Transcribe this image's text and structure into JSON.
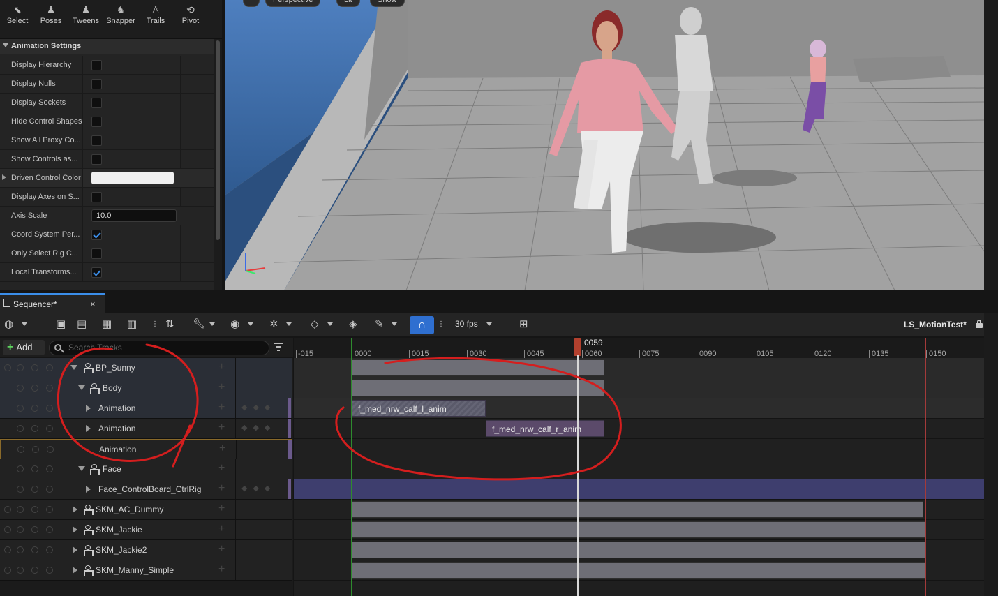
{
  "toolbar": {
    "tools": [
      {
        "label": "Select",
        "icon": "select-cursor-icon"
      },
      {
        "label": "Poses",
        "icon": "poses-icon"
      },
      {
        "label": "Tweens",
        "icon": "tweens-icon"
      },
      {
        "label": "Snapper",
        "icon": "snapper-icon"
      },
      {
        "label": "Trails",
        "icon": "trails-icon"
      },
      {
        "label": "Pivot",
        "icon": "pivot-icon"
      }
    ]
  },
  "animation_settings": {
    "header": "Animation Settings",
    "rows": [
      {
        "label": "Display Hierarchy",
        "type": "checkbox",
        "checked": false
      },
      {
        "label": "Display Nulls",
        "type": "checkbox",
        "checked": false
      },
      {
        "label": "Display Sockets",
        "type": "checkbox",
        "checked": false
      },
      {
        "label": "Hide Control Shapes",
        "type": "checkbox",
        "checked": false
      },
      {
        "label": "Show All Proxy Co...",
        "type": "checkbox",
        "checked": false
      },
      {
        "label": "Show Controls as...",
        "type": "checkbox",
        "checked": false
      },
      {
        "label": "Driven Control Color",
        "type": "color",
        "value": "#F0F0F0"
      },
      {
        "label": "Display Axes on S...",
        "type": "checkbox",
        "checked": false
      },
      {
        "label": "Axis Scale",
        "type": "number",
        "value": "10.0"
      },
      {
        "label": "Coord System Per...",
        "type": "checkbox",
        "checked": true
      },
      {
        "label": "Only Select Rig C...",
        "type": "checkbox",
        "checked": false
      },
      {
        "label": "Local Transforms...",
        "type": "checkbox",
        "checked": true
      }
    ]
  },
  "viewport": {
    "pills": [
      "Perspective",
      "Lit",
      "Show"
    ],
    "axis_labels": {
      "z": "Z",
      "y": "Y",
      "x": "X"
    }
  },
  "sequencer": {
    "tab_label": "Sequencer*",
    "tab_close": "×",
    "fps": "30 fps",
    "sequence_name": "LS_MotionTest*",
    "add_label": "Add",
    "search_placeholder": "Search Tracks",
    "playhead": "0059",
    "ruler_ticks": [
      "-015",
      "0000",
      "0015",
      "0030",
      "0045",
      "0060",
      "0075",
      "0090",
      "0105",
      "0120",
      "0135",
      "0150"
    ],
    "tracks": [
      {
        "label": "BP_Sunny",
        "caret": "down",
        "icon": "actor-icon"
      },
      {
        "label": "Body",
        "caret": "down",
        "icon": "skeleton-icon"
      },
      {
        "label": "Animation",
        "caret": "right",
        "icon": ""
      },
      {
        "label": "Animation",
        "caret": "right",
        "icon": ""
      },
      {
        "label": "Animation",
        "caret": "",
        "icon": ""
      },
      {
        "label": "Face",
        "caret": "down",
        "icon": "skeleton-icon"
      },
      {
        "label": "Face_ControlBoard_CtrlRig",
        "caret": "right",
        "icon": ""
      },
      {
        "label": "SKM_AC_Dummy",
        "caret": "right",
        "icon": "skeleton-icon"
      },
      {
        "label": "SKM_Jackie",
        "caret": "right",
        "icon": "skeleton-icon"
      },
      {
        "label": "SKM_Jackie2",
        "caret": "right",
        "icon": "skeleton-icon"
      },
      {
        "label": "SKM_Manny_Simple",
        "caret": "right",
        "icon": "skeleton-icon"
      }
    ],
    "sections": [
      {
        "label": "f_med_nrw_calf_l_anim"
      },
      {
        "label": "f_med_nrw_calf_r_anim"
      }
    ]
  },
  "colors": {
    "accent": "#2F6FD0",
    "playhead": "#B2402E",
    "annotation": "#D41E1E",
    "start_marker": "#2E8B2E",
    "end_marker": "#A33A3A"
  }
}
